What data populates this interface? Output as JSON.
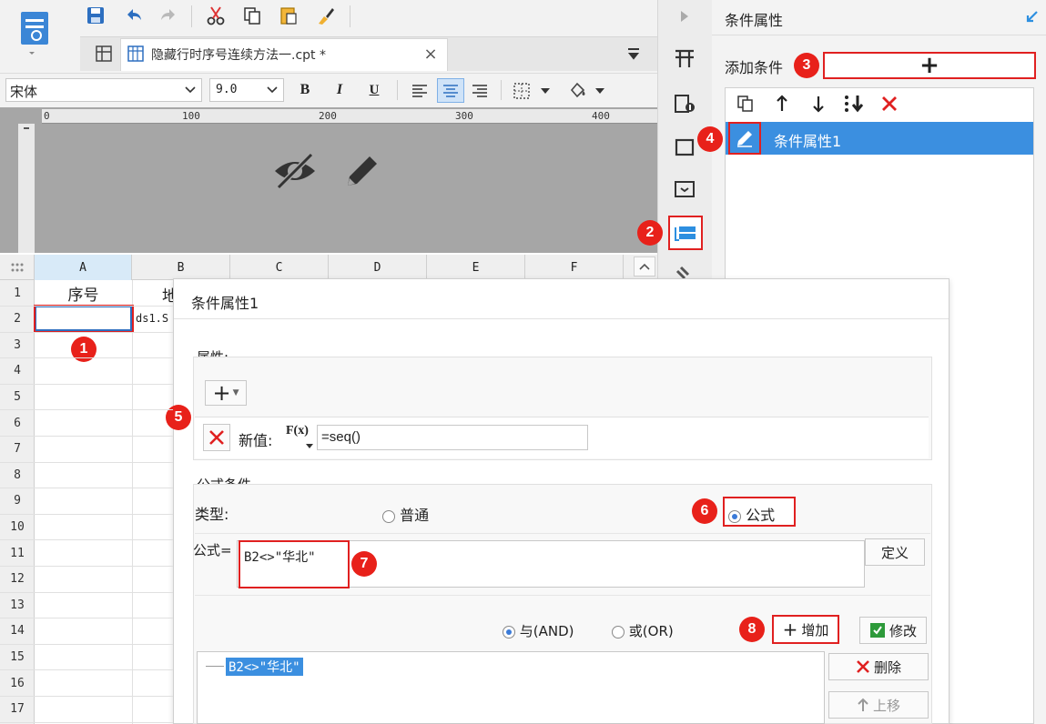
{
  "tab": {
    "title": "隐藏行时序号连续方法一.cpt *"
  },
  "format": {
    "font_name": "宋体",
    "font_size": "9.0"
  },
  "ruler": [
    "0",
    "100",
    "200",
    "300",
    "400"
  ],
  "sheet": {
    "columns": [
      "A",
      "B",
      "C",
      "D",
      "E",
      "F"
    ],
    "rows": [
      "1",
      "2",
      "3",
      "4",
      "5",
      "6",
      "7",
      "8",
      "9",
      "10",
      "11",
      "12",
      "13",
      "14",
      "15",
      "16",
      "17"
    ],
    "a1": "序号",
    "b1": "地",
    "b2": "ds1.S"
  },
  "right_panel": {
    "title": "条件属性",
    "add_label": "添加条件",
    "add_button": "+",
    "list_item": "条件属性1"
  },
  "dialog": {
    "title": "条件属性1",
    "attr_legend": "属性:",
    "attr_add": "+",
    "new_value_label": "新值:",
    "fx_label": "F(x)",
    "new_value": "=seq()",
    "formula_legend": "公式条件",
    "type_label": "类型:",
    "type_normal": "普通",
    "type_formula": "公式",
    "formula_label": "公式=",
    "formula_value": "B2<>\"华北\"",
    "define_button": "定义",
    "and_label": "与(AND)",
    "or_label": "或(OR)",
    "add_button": "增加",
    "modify_button": "修改",
    "delete_button": "删除",
    "up_button": "上移",
    "condition_list": [
      "B2<>\"华北\""
    ]
  },
  "markers": [
    "1",
    "2",
    "3",
    "4",
    "5",
    "6",
    "7",
    "8"
  ],
  "colors": {
    "accent": "#3b8fe0",
    "marker": "#e8211a",
    "selected_row": "#3b8fe0",
    "canvas": "#a6a6a6"
  }
}
